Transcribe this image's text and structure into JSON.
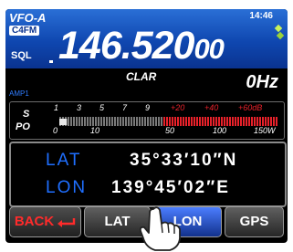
{
  "header": {
    "vfo_label": "VFO-A",
    "mode_label": "C4FM",
    "sql_label": "SQL",
    "clock": "14:46",
    "frequency_main": "146.520",
    "frequency_sub": "00"
  },
  "clar_row": {
    "clar_label": "CLAR",
    "offset": "0Hz",
    "amp_label": "AMP1"
  },
  "meter": {
    "s_label": "S",
    "po_label": "PO",
    "s_ticks": [
      "1",
      "3",
      "5",
      "7",
      "9"
    ],
    "s_plus_ticks": [
      "+20",
      "+40",
      "+60dB"
    ],
    "po_ticks": [
      "0",
      "10",
      "50",
      "100",
      "150W"
    ],
    "signal_level_fraction": 0.35
  },
  "gps": {
    "lat_label": "LAT",
    "lat_value": "35°33′10″N",
    "lon_label": "LON",
    "lon_value": "139°45′02″E"
  },
  "buttons": {
    "back": "BACK",
    "lat": "LAT",
    "lon": "LON",
    "gps": "GPS"
  },
  "colors": {
    "top_panel": "#1a5bc9",
    "label_blue": "#1f6fff",
    "meter_red": "#e8212a",
    "back_red": "#ff2b2b"
  }
}
